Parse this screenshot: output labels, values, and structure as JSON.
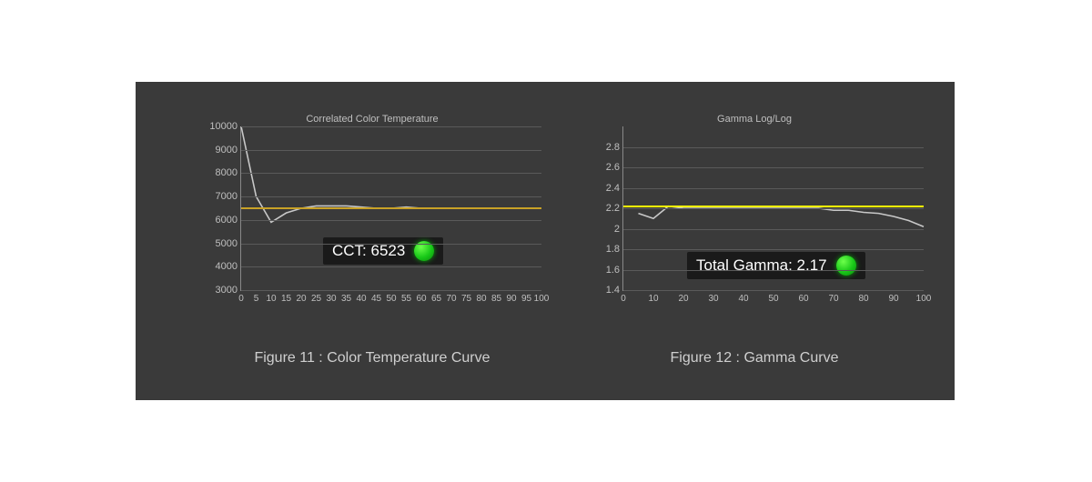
{
  "chart_data": [
    {
      "type": "line",
      "title": "Correlated Color Temperature",
      "caption": "Figure 11 : Color Temperature Curve",
      "xlabel": "",
      "ylabel": "",
      "xlim": [
        0,
        100
      ],
      "ylim": [
        3000,
        10000
      ],
      "x_ticks": [
        0,
        5,
        10,
        15,
        20,
        25,
        30,
        35,
        40,
        45,
        50,
        55,
        60,
        65,
        70,
        75,
        80,
        85,
        90,
        95,
        100
      ],
      "y_ticks": [
        3000,
        4000,
        5000,
        6000,
        7000,
        8000,
        9000,
        10000
      ],
      "x": [
        0,
        5,
        10,
        15,
        20,
        25,
        30,
        35,
        40,
        45,
        50,
        55,
        60,
        65,
        70,
        75,
        80,
        85,
        90,
        95,
        100
      ],
      "values": [
        10000,
        7000,
        5900,
        6300,
        6500,
        6600,
        6600,
        6600,
        6550,
        6500,
        6500,
        6550,
        6500,
        6500,
        6500,
        6500,
        6500,
        6500,
        6500,
        6500,
        6500
      ],
      "reference": {
        "value": 6500,
        "color": "#c9a227"
      },
      "badge": {
        "label": "CCT: 6523",
        "status_color": "#18c818"
      }
    },
    {
      "type": "line",
      "title": "Gamma Log/Log",
      "caption": "Figure 12 : Gamma Curve",
      "xlabel": "",
      "ylabel": "",
      "xlim": [
        0,
        100
      ],
      "ylim": [
        1.4,
        3.0
      ],
      "x_ticks": [
        0,
        10,
        20,
        30,
        40,
        50,
        60,
        70,
        80,
        90,
        100
      ],
      "y_ticks": [
        1.4,
        1.6,
        1.8,
        2.0,
        2.2,
        2.4,
        2.6,
        2.8
      ],
      "x": [
        5,
        10,
        15,
        20,
        25,
        30,
        35,
        40,
        45,
        50,
        55,
        60,
        65,
        70,
        75,
        80,
        85,
        90,
        95,
        100
      ],
      "values": [
        2.15,
        2.1,
        2.22,
        2.2,
        2.2,
        2.2,
        2.2,
        2.2,
        2.2,
        2.2,
        2.2,
        2.2,
        2.2,
        2.18,
        2.18,
        2.16,
        2.15,
        2.12,
        2.08,
        2.02
      ],
      "reference": {
        "value": 2.22,
        "color": "#ffff00"
      },
      "badge": {
        "label": "Total Gamma: 2.17",
        "status_color": "#18c818"
      }
    }
  ]
}
